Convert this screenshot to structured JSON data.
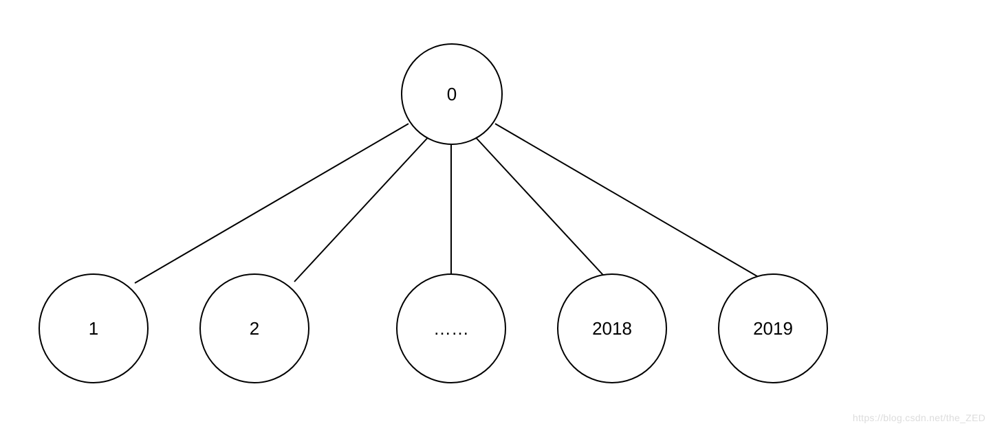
{
  "tree": {
    "root": {
      "label": "0"
    },
    "children": [
      {
        "label": "1"
      },
      {
        "label": "2"
      },
      {
        "label": "……"
      },
      {
        "label": "2018"
      },
      {
        "label": "2019"
      }
    ]
  },
  "watermark": "https://blog.csdn.net/the_ZED"
}
